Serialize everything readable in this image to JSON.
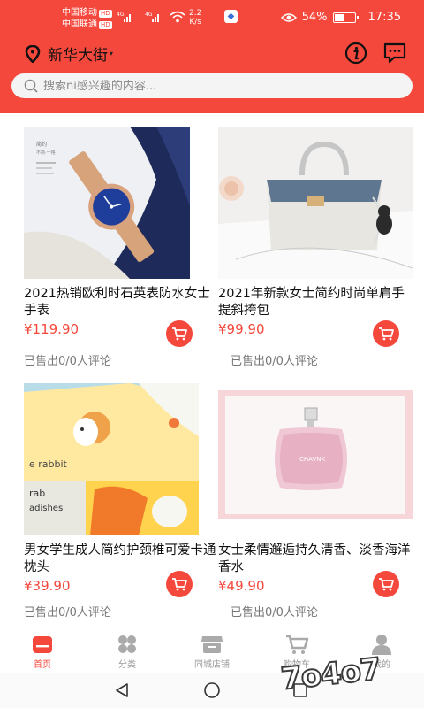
{
  "status_bar": {
    "carrier1": "中国移动",
    "carrier2": "中国联通",
    "hd": "HD",
    "net1": "4G",
    "net2": "4G",
    "speed_value": "2.2",
    "speed_unit": "K/s",
    "battery_percent": "54%",
    "battery_level": 0.54,
    "time": "17:35"
  },
  "header": {
    "location": "新华大街",
    "location_icon": "location-pin-icon",
    "info_icon": "info-icon",
    "message_icon": "message-icon"
  },
  "search": {
    "placeholder": "搜索ni感兴趣的内容..."
  },
  "products": [
    {
      "title": "2021热销欧利时石英表防水女士手表",
      "price": "¥119.90",
      "sold": "已售出0/0人评论",
      "image": "watch"
    },
    {
      "title": "2021年新款女士简约时尚单肩手提斜挎包",
      "price": "¥99.90",
      "sold": "已售出0/0人评论",
      "image": "handbag"
    },
    {
      "title": "男女学生成人简约护颈椎可爱卡通枕头",
      "price": "¥39.90",
      "sold": "已售出0/0人评论",
      "image": "pillow"
    },
    {
      "title": "女士柔情邂逅持久清香、淡香海洋香水",
      "price": "¥49.90",
      "sold": "已售出0/0人评论",
      "image": "perfume"
    }
  ],
  "image_text": {
    "watch_line1": "简约",
    "watch_line2": "不简·一格",
    "pillow_text1": "e rabbit",
    "pillow_text2": "rab",
    "pillow_text3": "adishes",
    "perfume_label": "CHAVNK"
  },
  "tabs": [
    {
      "label": "首页",
      "icon": "home-icon",
      "active": true
    },
    {
      "label": "分类",
      "icon": "category-icon",
      "active": false
    },
    {
      "label": "同城店铺",
      "icon": "store-icon",
      "active": false
    },
    {
      "label": "购物车",
      "icon": "cart-icon",
      "active": false
    },
    {
      "label": "我的",
      "icon": "user-icon",
      "active": false
    }
  ],
  "watermark": "7o4o7",
  "colors": {
    "accent": "#f5483d",
    "price": "#f5483d"
  }
}
